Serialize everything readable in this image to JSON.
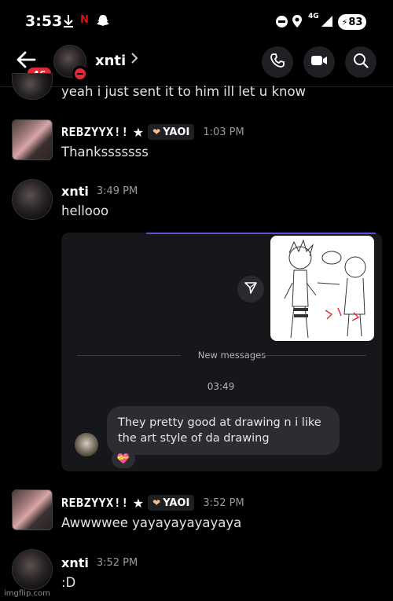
{
  "status_bar": {
    "time": "3:53",
    "network": "4G",
    "battery": "83",
    "icons": [
      "download-icon",
      "netflix-icon",
      "snapchat-icon",
      "dnd-icon",
      "location-icon",
      "signal-icon",
      "battery-icon"
    ]
  },
  "header": {
    "unread_badge": "46",
    "channel_name": "xnti",
    "icons": [
      "back-arrow-icon",
      "phone-call-icon",
      "video-call-icon",
      "search-icon"
    ]
  },
  "messages": [
    {
      "text": "yeah i just sent it to him ill let u know"
    },
    {
      "author": "REBZYYX!!",
      "star": "★",
      "tag": "YAOI",
      "time": "1:03 PM",
      "text": "Thanksssssss"
    },
    {
      "author": "xnti",
      "time": "3:49 PM",
      "text": "hellooo"
    },
    {
      "author": "REBZYYX!!",
      "star": "★",
      "tag": "YAOI",
      "time": "3:52 PM",
      "text": "Awwwwee yayayayayayaya"
    },
    {
      "author": "xnti",
      "time": "3:52 PM",
      "text": ":D"
    }
  ],
  "embed": {
    "new_messages_label": "New messages",
    "timestamp": "03:49",
    "bubble_text": "They pretty good at drawing n i like the art style of da drawing",
    "reaction": "💝"
  },
  "watermark": "imgflip.com",
  "colors": {
    "accent_purple": "#6b4bd8",
    "badge_red": "#e02a3a",
    "background": "#000000"
  }
}
